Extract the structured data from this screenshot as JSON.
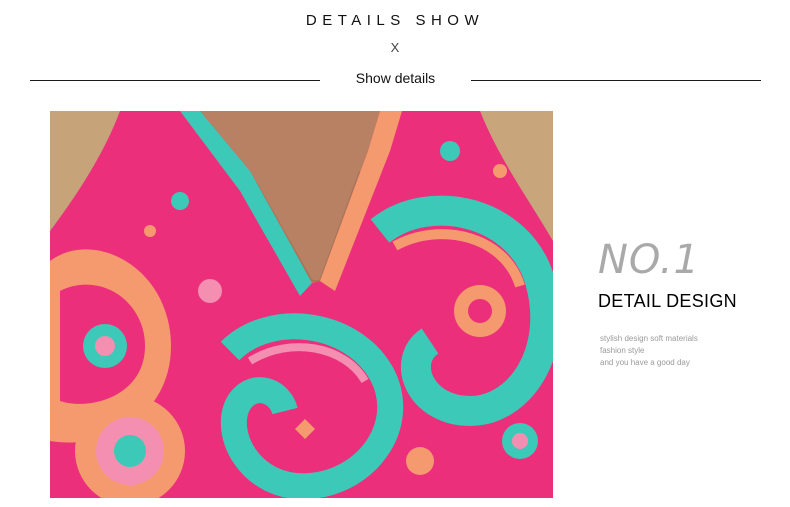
{
  "header": {
    "title": "DETAILS SHOW",
    "close_symbol": "X",
    "subtitle": "Show details"
  },
  "feature": {
    "number": "NO.1",
    "heading": "DETAIL DESIGN",
    "description_lines": [
      "stylish design soft materials",
      "fashion style",
      "and you have a good day"
    ]
  },
  "colors": {
    "fabric_base": "#ec2f7b",
    "paisley_turquoise": "#3cc9b8",
    "paisley_peach": "#f59a6e",
    "skin": "#b98163",
    "accent_gray": "#a9a9a9"
  }
}
